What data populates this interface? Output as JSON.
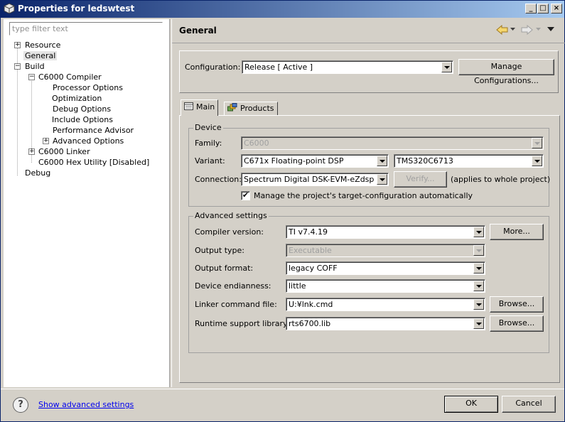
{
  "window": {
    "title": "Properties for ledswtest"
  },
  "filter": {
    "placeholder": "type filter text"
  },
  "tree": {
    "resource": "Resource",
    "general": "General",
    "build": "Build",
    "compiler": "C6000 Compiler",
    "processor_options": "Processor Options",
    "optimization": "Optimization",
    "debug_options": "Debug Options",
    "include_options": "Include Options",
    "performance_advisor": "Performance Advisor",
    "advanced_options": "Advanced Options",
    "linker": "C6000 Linker",
    "hex_utility": "C6000 Hex Utility  [Disabled]",
    "debug": "Debug"
  },
  "page": {
    "title": "General"
  },
  "configuration": {
    "label": "Configuration:",
    "value": "Release  [ Active ]",
    "manage_button": "Manage Configurations..."
  },
  "tabs": {
    "main": "Main",
    "products": "Products"
  },
  "device": {
    "group_label": "Device",
    "family_label": "Family:",
    "family_value": "C6000",
    "variant_label": "Variant:",
    "variant_value": "C671x Floating-point DSP",
    "variant_device": "TMS320C6713",
    "connection_label": "Connection:",
    "connection_value": "Spectrum Digital DSK-EVM-eZdsp o",
    "verify_button": "Verify...",
    "applies_note": "(applies to whole project)",
    "manage_checkbox_label": "Manage the project's target-configuration automatically",
    "manage_checked": true
  },
  "advanced": {
    "group_label": "Advanced settings",
    "compiler_version_label": "Compiler version:",
    "compiler_version_value": "TI v7.4.19",
    "more_button": "More...",
    "output_type_label": "Output type:",
    "output_type_value": "Executable",
    "output_format_label": "Output format:",
    "output_format_value": "legacy COFF",
    "endianness_label": "Device endianness:",
    "endianness_value": "little",
    "linker_cmd_label": "Linker command file:",
    "linker_cmd_value": "U:¥lnk.cmd",
    "browse_button_1": "Browse...",
    "runtime_lib_label": "Runtime support library:",
    "runtime_lib_value": "rts6700.lib",
    "browse_button_2": "Browse..."
  },
  "footer": {
    "help_symbol": "?",
    "advanced_link": "Show advanced settings",
    "ok_button": "OK",
    "cancel_button": "Cancel"
  },
  "window_buttons": {
    "minimize": "_",
    "maximize": "□",
    "close": "×"
  },
  "colors": {
    "titlebar_start": "#0a246a",
    "titlebar_end": "#a6caf0",
    "link": "#0000ee",
    "dialog_bg": "#d4d0c8"
  },
  "icons": [
    "app-icon",
    "back-arrow-icon",
    "forward-arrow-icon",
    "view-menu-icon",
    "main-tab-icon",
    "products-tab-icon",
    "help-icon",
    "checkmark-icon"
  ]
}
